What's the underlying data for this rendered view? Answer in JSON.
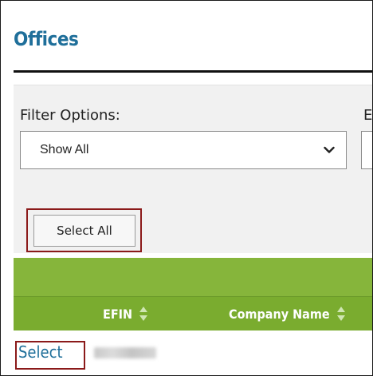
{
  "page": {
    "title": "Offices"
  },
  "filters": {
    "filter_options_label": "Filter Options:",
    "filter_options_value": "Show All",
    "second_filter_label_partial": "E"
  },
  "actions": {
    "select_all_label": "Select All"
  },
  "grid": {
    "columns": [
      {
        "label": "EFIN",
        "sortable": true
      },
      {
        "label": "Company Name",
        "sortable": true
      }
    ],
    "rows": [
      {
        "action_label": "Select",
        "efin_obscured": true
      }
    ]
  },
  "colors": {
    "title_blue": "#1f6f9a",
    "grid_green": "#86b53b",
    "highlight_red": "#8b1a1a"
  },
  "icons": {
    "dropdown": "chevron-down-icon",
    "sort": "sort-icon"
  }
}
